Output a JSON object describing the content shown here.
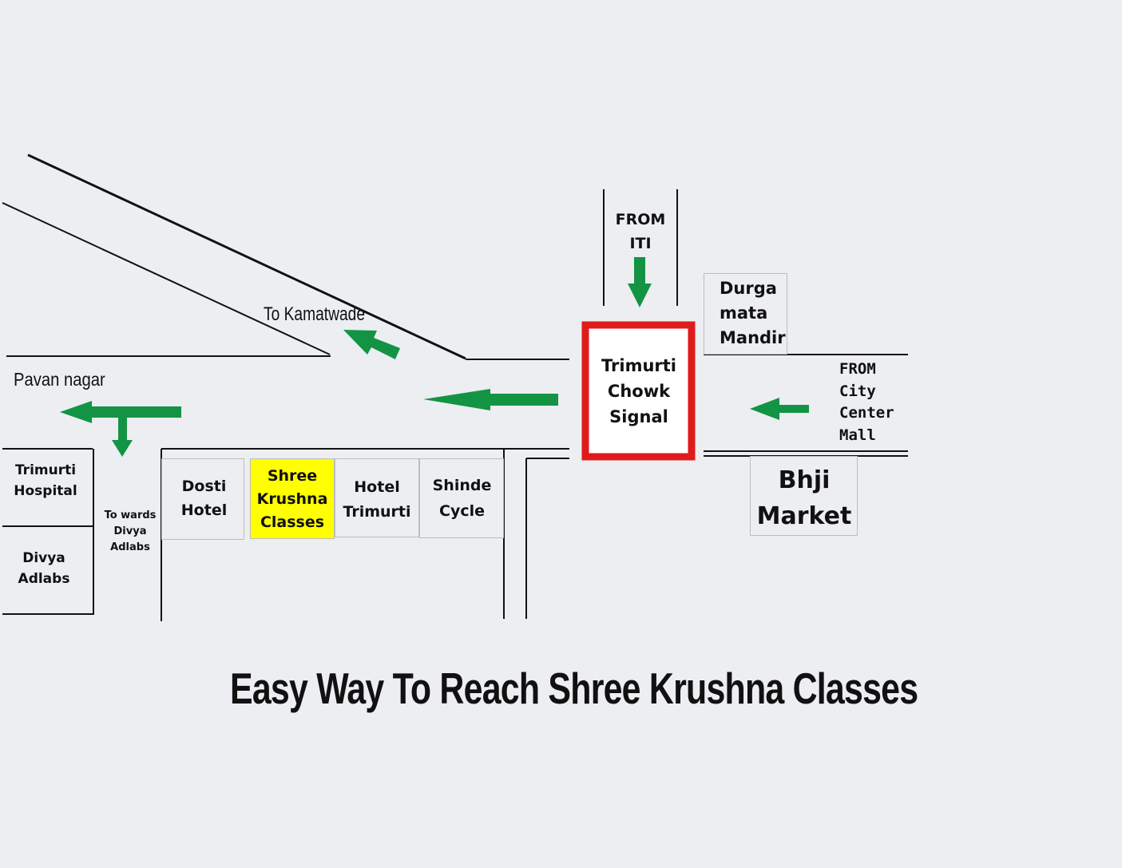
{
  "title": "Easy Way To Reach Shree Krushna Classes",
  "signal": {
    "label": "Trimurti\nChowk\nSignal",
    "border_color": "#e01b1b"
  },
  "from_iti": "FROM\nITI",
  "from_city_center": "FROM\nCity\nCenter\nMall",
  "durga_mandir": "Durga\nmata\nMandir",
  "bhji_market": "Bhji\nMarket",
  "to_kamatwade": "To Kamatwade",
  "pavan_nagar": "Pavan nagar",
  "towards_divya": "To wards\nDivya\nAdlabs",
  "trimurti_hospital": "Trimurti\nHospital",
  "divya_adlabs": "Divya\nAdlabs",
  "dosti_hotel": "Dosti\nHotel",
  "shree_krushna": {
    "label": "Shree\nKrushna\nClasses",
    "highlight_color": "#ffff00"
  },
  "hotel_trimurti": "Hotel\nTrimurti",
  "shinde_cycle": "Shinde\nCycle",
  "colors": {
    "arrow": "#139444",
    "road": "#111111"
  }
}
